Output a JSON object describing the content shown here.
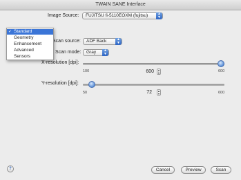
{
  "window": {
    "title": "TWAIN SANE Interface"
  },
  "image_source": {
    "label": "Image Source:",
    "value": "FUJITSU fi-5110EOXM (fujitsu)"
  },
  "option_group_menu": {
    "items": [
      {
        "label": "Standard",
        "selected": true
      },
      {
        "label": "Geometry",
        "selected": false
      },
      {
        "label": "Enhancement",
        "selected": false
      },
      {
        "label": "Advanced",
        "selected": false
      },
      {
        "label": "Sensors",
        "selected": false
      }
    ]
  },
  "scan_source": {
    "label": "Scan source:",
    "value": "ADF Back"
  },
  "scan_mode": {
    "label": "Scan mode:",
    "value": "Gray"
  },
  "x_resolution": {
    "label": "X-resolution [dpi]:",
    "min": "100",
    "max": "600",
    "value": "600",
    "level": 1.0
  },
  "y_resolution": {
    "label": "Y-resolution [dpi]:",
    "min": "50",
    "max": "600",
    "value": "72",
    "level": 0.04
  },
  "buttons": {
    "cancel": "Cancel",
    "preview": "Preview",
    "scan": "Scan"
  },
  "help": {
    "glyph": "?"
  },
  "icons": {
    "check": "✓",
    "up": "▲",
    "down": "▼"
  }
}
